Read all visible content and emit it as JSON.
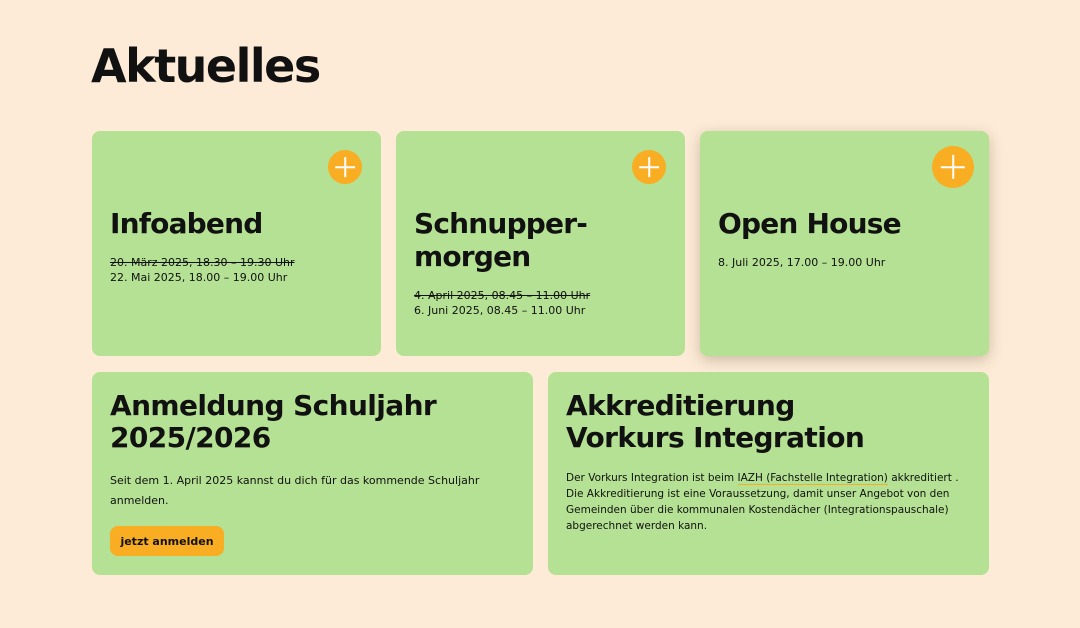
{
  "heading": "Aktuelles",
  "events": [
    {
      "title_line1": "Infoabend",
      "date_old": "20. März 2025, 18.30 – 19.30 Uhr",
      "date_new": "22. Mai 2025, 18.00 – 19.00 Uhr"
    },
    {
      "title_line1": "Schnupper-",
      "title_line2": "morgen",
      "date_old": "4. April 2025, 08.45 – 11.00 Uhr",
      "date_new": "6. Juni 2025, 08.45 – 11.00 Uhr"
    },
    {
      "title_line1": "Open House",
      "date_new": "8. Juli 2025, 17.00 – 19.00 Uhr"
    }
  ],
  "registration": {
    "title_line1": "Anmeldung Schuljahr",
    "title_line2": "2025/2026",
    "text_line1": "Seit dem 1. April 2025 kannst du dich für das kommende Schuljahr",
    "text_line2": "anmelden.",
    "button_label": "jetzt anmelden"
  },
  "accreditation": {
    "title_line1": "Akkreditierung",
    "title_line2": "Vorkurs Integration",
    "text_before_link": "Der Vorkurs Integration ist beim ",
    "link_text": "IAZH (Fachstelle Integration)",
    "text_after_link": " akkreditiert .",
    "text_line2": "Die Akkreditierung ist eine Voraussetzung, damit unser Angebot von den",
    "text_line3": "Gemeinden über die kommunalen Kostendächer (Integrationspauschale)",
    "text_line4": "abgerechnet werden kann."
  },
  "colors": {
    "background": "#fdebd7",
    "card": "#b4e193",
    "accent": "#f9ad22"
  },
  "icons": [
    "plus-icon"
  ]
}
